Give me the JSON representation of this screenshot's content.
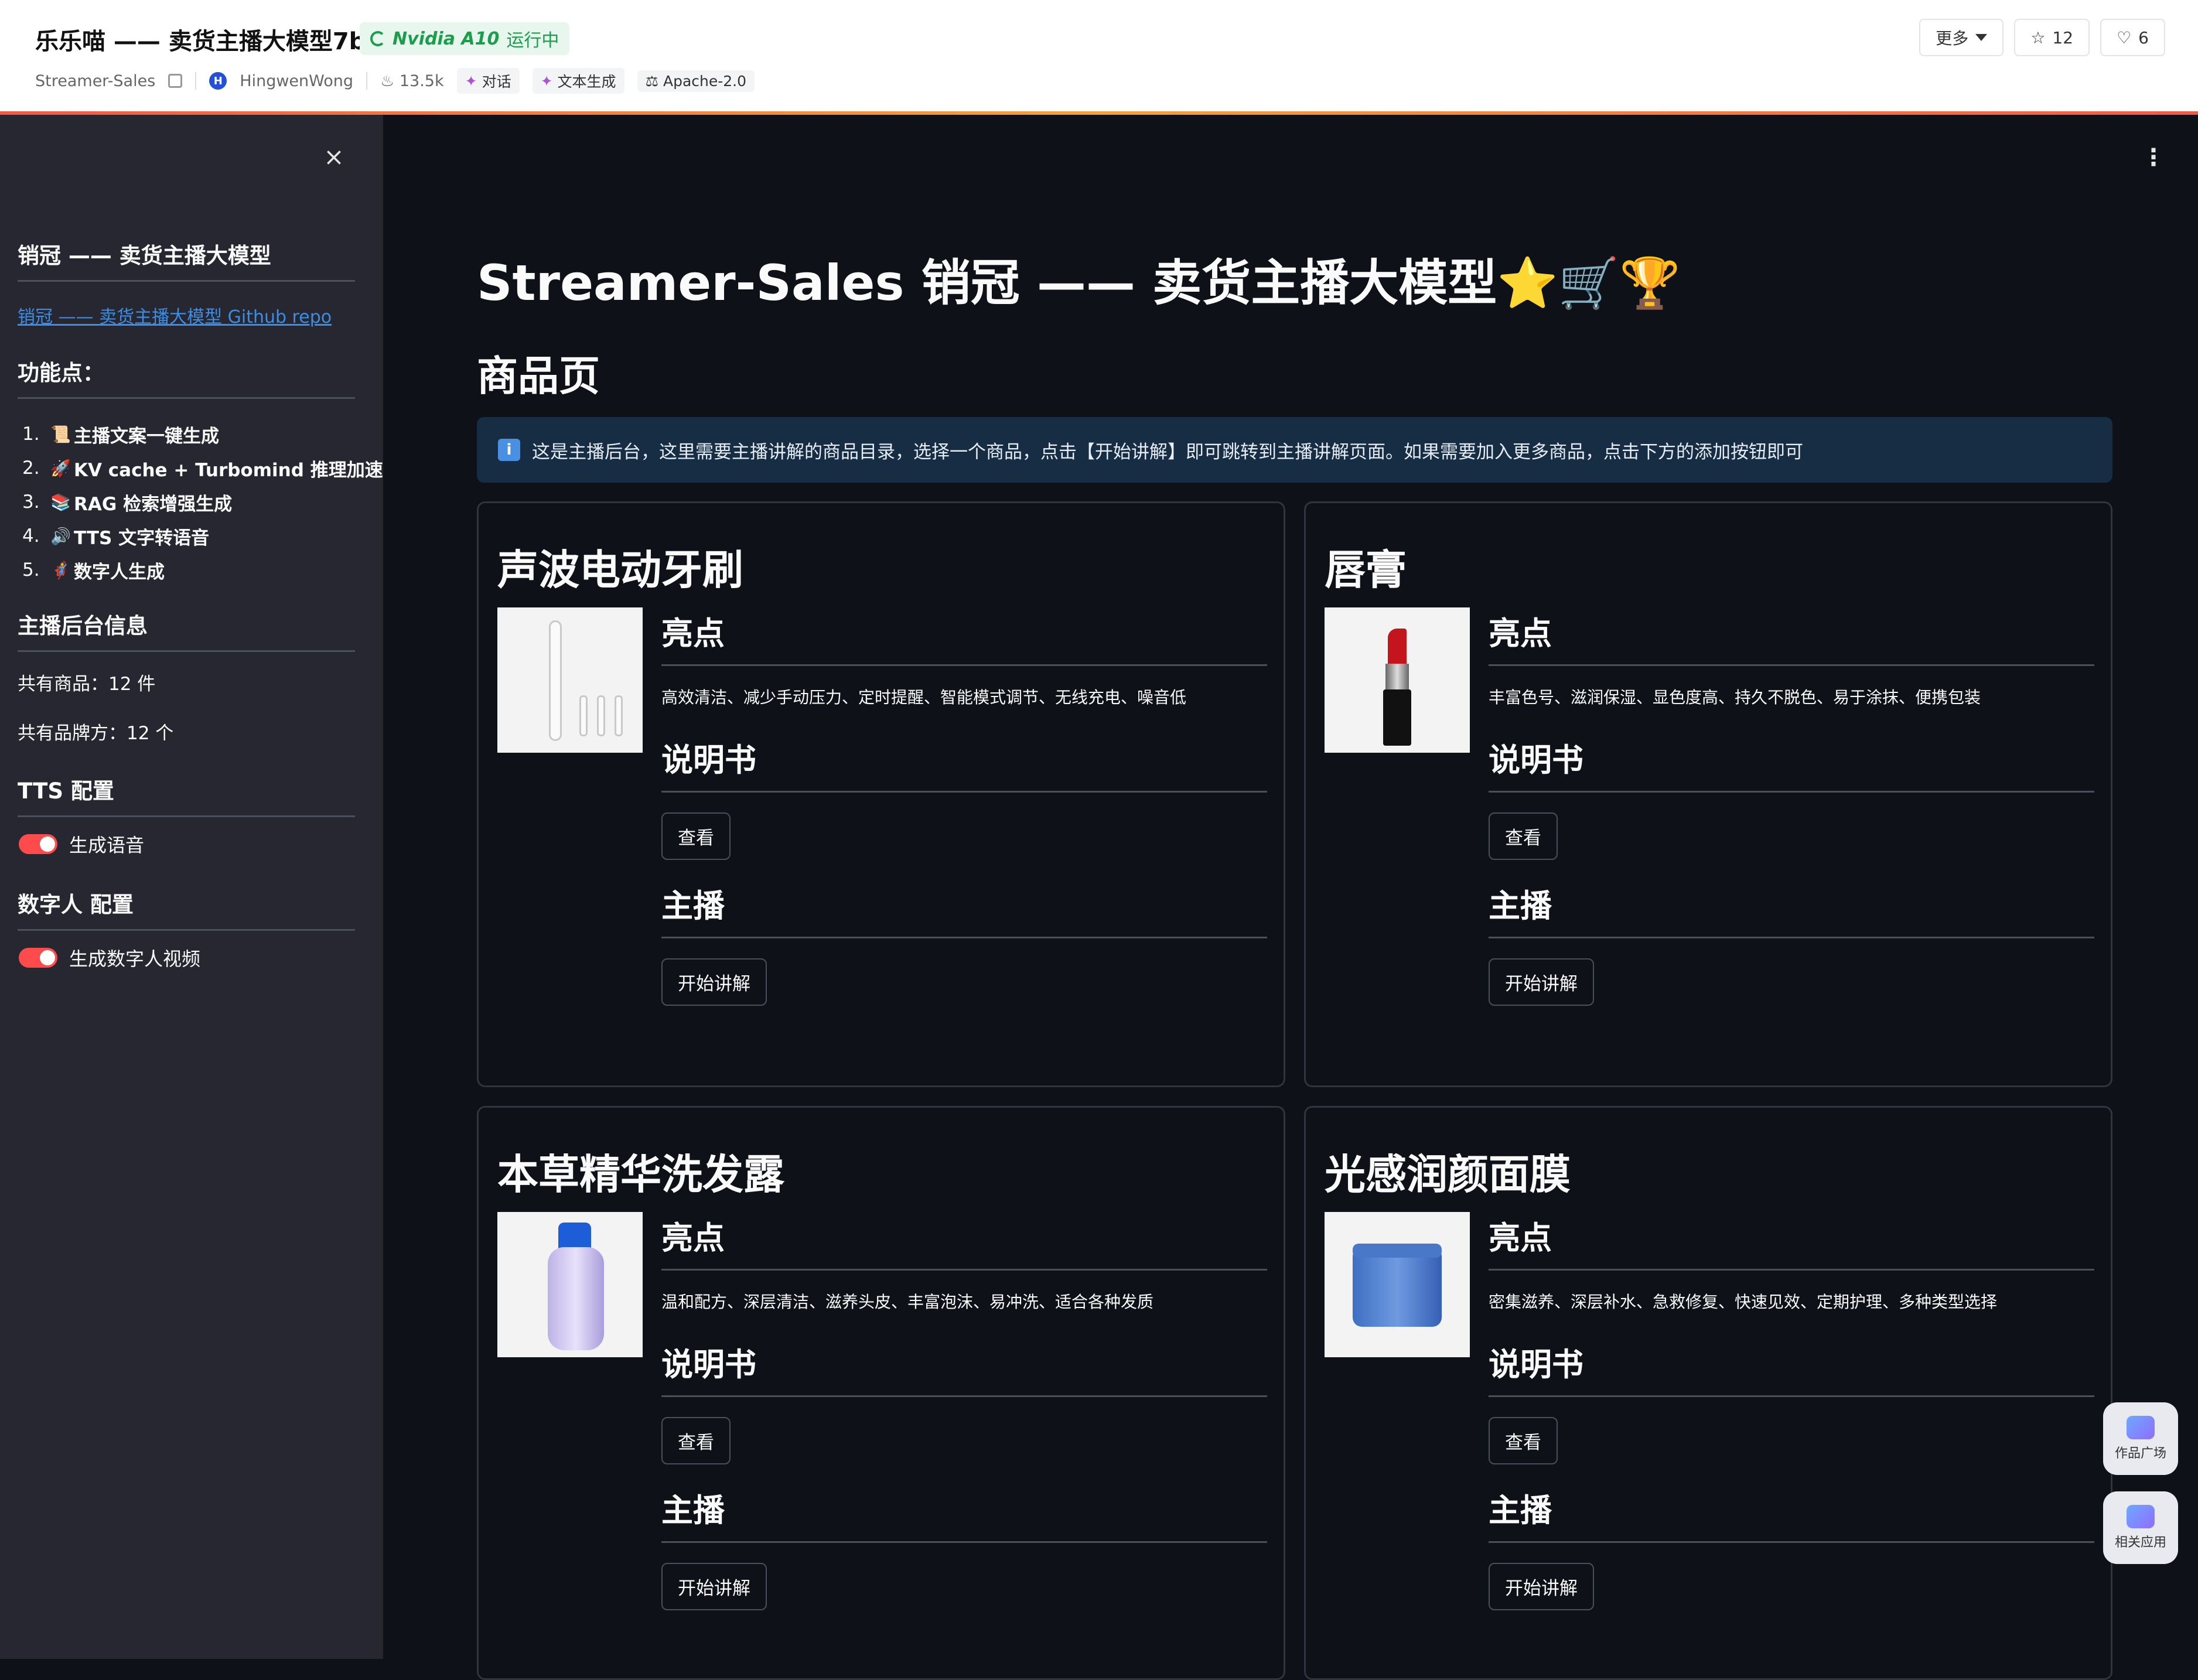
{
  "header": {
    "title": "乐乐喵 —— 卖货主播大模型7b",
    "status": {
      "hardware": "Nvidia A10",
      "state": "运行中"
    },
    "repo": "Streamer-Sales",
    "owner_initial": "H",
    "owner": "HingwenWong",
    "likes_views": "13.5k",
    "tags": [
      "对话",
      "文本生成"
    ],
    "license": "Apache-2.0",
    "more_label": "更多",
    "stars": "12",
    "favorites": "6"
  },
  "sidebar": {
    "title": "销冠 —— 卖货主播大模型",
    "repo_link": "销冠 —— 卖货主播大模型 Github repo",
    "features_heading": "功能点：",
    "features": [
      {
        "num": "1.",
        "icon": "📜",
        "label": "主播文案一键生成"
      },
      {
        "num": "2.",
        "icon": "🚀",
        "label": "KV cache + Turbomind 推理加速"
      },
      {
        "num": "3.",
        "icon": "📚",
        "label": "RAG 检索增强生成"
      },
      {
        "num": "4.",
        "icon": "🔊",
        "label": "TTS 文字转语音"
      },
      {
        "num": "5.",
        "icon": "🦸",
        "label": "数字人生成"
      }
    ],
    "backend_heading": "主播后台信息",
    "product_count": "共有商品：12 件",
    "brand_count": "共有品牌方：12 个",
    "tts_heading": "TTS 配置",
    "tts_toggle": "生成语音",
    "digital_heading": "数字人 配置",
    "digital_toggle": "生成数字人视频"
  },
  "main": {
    "title": "Streamer-Sales 销冠 —— 卖货主播大模型⭐🛒🏆",
    "section": "商品页",
    "info": "这是主播后台，这里需要主播讲解的商品目录，选择一个商品，点击【开始讲解】即可跳转到主播讲解页面。如果需要加入更多商品，点击下方的添加按钮即可",
    "highlight_label": "亮点",
    "manual_label": "说明书",
    "view_label": "查看",
    "host_label": "主播",
    "start_label": "开始讲解",
    "products": [
      {
        "name": "声波电动牙刷",
        "highlights": "高效清洁、减少手动压力、定时提醒、智能模式调节、无线充电、噪音低"
      },
      {
        "name": "唇膏",
        "highlights": "丰富色号、滋润保湿、显色度高、持久不脱色、易于涂抹、便携包装"
      },
      {
        "name": "本草精华洗发露",
        "highlights": "温和配方、深层清洁、滋养头皮、丰富泡沫、易冲洗、适合各种发质"
      },
      {
        "name": "光感润颜面膜",
        "highlights": "密集滋养、深层补水、急救修复、快速见效、定期护理、多种类型选择"
      }
    ]
  },
  "floats": {
    "gallery": "作品广场",
    "related": "相关应用"
  }
}
